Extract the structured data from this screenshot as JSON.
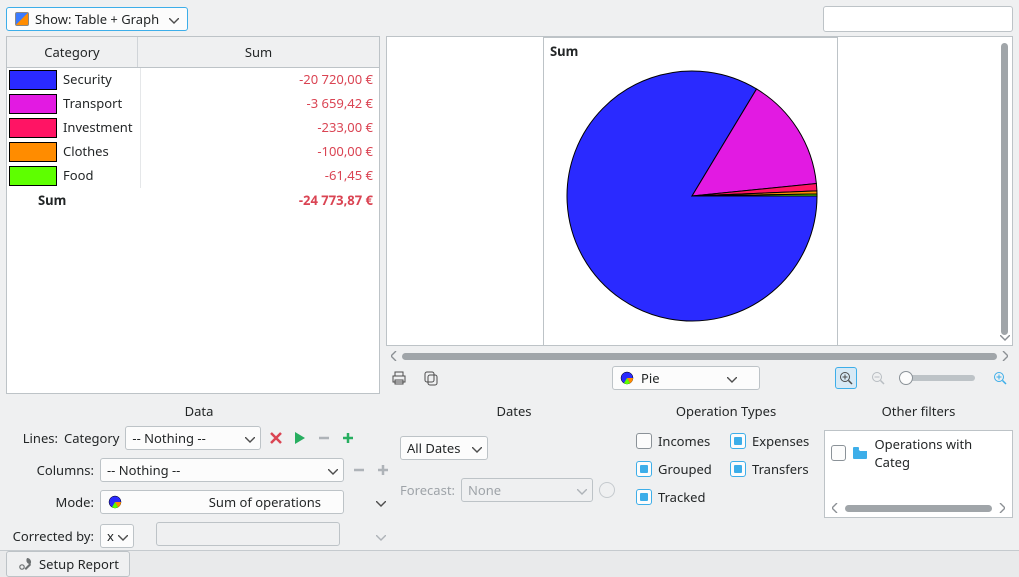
{
  "toolbar": {
    "show_button_label": "Show: Table + Graph"
  },
  "table": {
    "headers": {
      "category": "Category",
      "sum": "Sum"
    },
    "rows": [
      {
        "color": "#2a2aff",
        "name": "Security",
        "value": "-20 720,00 €"
      },
      {
        "color": "#e21ae2",
        "name": "Transport",
        "value": "-3 659,42 €"
      },
      {
        "color": "#ff1464",
        "name": "Investment",
        "value": "-233,00 €"
      },
      {
        "color": "#ff8c00",
        "name": "Clothes",
        "value": "-100,00 €"
      },
      {
        "color": "#5eff00",
        "name": "Food",
        "value": "-61,45 €"
      }
    ],
    "total": {
      "label": "Sum",
      "value": "-24 773,87 €"
    }
  },
  "graph": {
    "title": "Sum",
    "type_selector_value": "Pie"
  },
  "chart_data": {
    "type": "pie",
    "title": "Sum",
    "series": [
      {
        "name": "Security",
        "value": 20720.0,
        "color": "#2a2aff"
      },
      {
        "name": "Transport",
        "value": 3659.42,
        "color": "#e21ae2"
      },
      {
        "name": "Investment",
        "value": 233.0,
        "color": "#ff1464"
      },
      {
        "name": "Clothes",
        "value": 100.0,
        "color": "#ff8c00"
      },
      {
        "name": "Food",
        "value": 61.45,
        "color": "#5eff00"
      }
    ]
  },
  "settings": {
    "data": {
      "heading": "Data",
      "lines_label": "Lines:",
      "lines_value": "Category",
      "lines_nothing": "-- Nothing --",
      "columns_label": "Columns:",
      "columns_value": "-- Nothing --",
      "mode_label": "Mode:",
      "mode_value": "Sum of operations",
      "corrected_label": "Corrected by:",
      "corrected_value": "x"
    },
    "dates": {
      "heading": "Dates",
      "range_value": "All Dates",
      "forecast_label": "Forecast:",
      "forecast_value": "None"
    },
    "optypes": {
      "heading": "Operation Types",
      "incomes": "Incomes",
      "expenses": "Expenses",
      "grouped": "Grouped",
      "transfers": "Transfers",
      "tracked": "Tracked"
    },
    "other": {
      "heading": "Other filters",
      "item0": "Operations with Categ"
    }
  },
  "bottom": {
    "setup_report": "Setup Report"
  }
}
